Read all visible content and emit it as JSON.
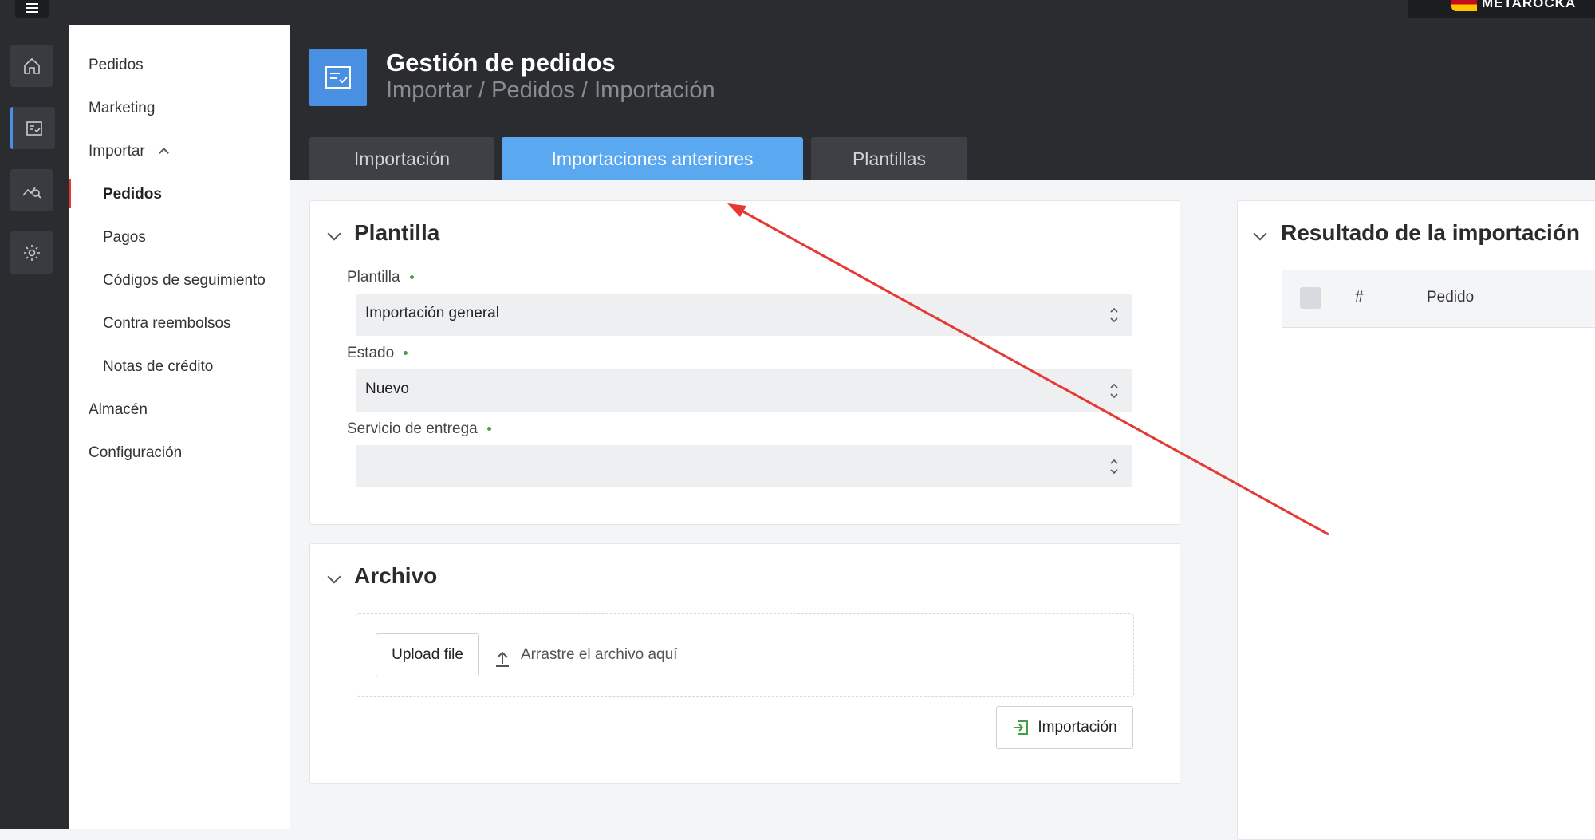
{
  "topbar": {
    "brand": "METAROCKA",
    "menu_icon": "hamburger-icon"
  },
  "rail": {
    "icons": [
      "home-icon",
      "orders-icon",
      "analytics-icon",
      "settings-icon"
    ],
    "active_index": 1
  },
  "submenu": {
    "items": [
      {
        "label": "Pedidos"
      },
      {
        "label": "Marketing"
      },
      {
        "label": "Importar",
        "expanded": true
      },
      {
        "label": "Pedidos"
      },
      {
        "label": "Pagos"
      },
      {
        "label": "Códigos de seguimiento"
      },
      {
        "label": "Contra reembolsos"
      },
      {
        "label": "Notas de crédito"
      },
      {
        "label": "Almacén"
      },
      {
        "label": "Configuración"
      }
    ],
    "active_index": 3
  },
  "header": {
    "title": "Gestión de pedidos",
    "breadcrumb": "Importar / Pedidos / Importación",
    "tabs": [
      {
        "label": "Importación"
      },
      {
        "label": "Importaciones anteriores"
      },
      {
        "label": "Plantillas"
      }
    ],
    "active_tab": 1
  },
  "plantilla_card": {
    "title": "Plantilla",
    "fields": [
      {
        "label": "Plantilla",
        "value": "Importación general"
      },
      {
        "label": "Estado",
        "value": "Nuevo"
      },
      {
        "label": "Servicio de entrega",
        "value": ""
      }
    ]
  },
  "archivo_card": {
    "title": "Archivo",
    "upload_label": "Upload file",
    "drop_hint": "Arrastre el archivo aquí",
    "import_label": "Importación"
  },
  "result_card": {
    "title": "Resultado de la importación",
    "columns": [
      "#",
      "Pedido"
    ]
  },
  "colors": {
    "accent": "#5aa9f0",
    "annotation": "#e53935",
    "required_dot": "#43a047"
  }
}
